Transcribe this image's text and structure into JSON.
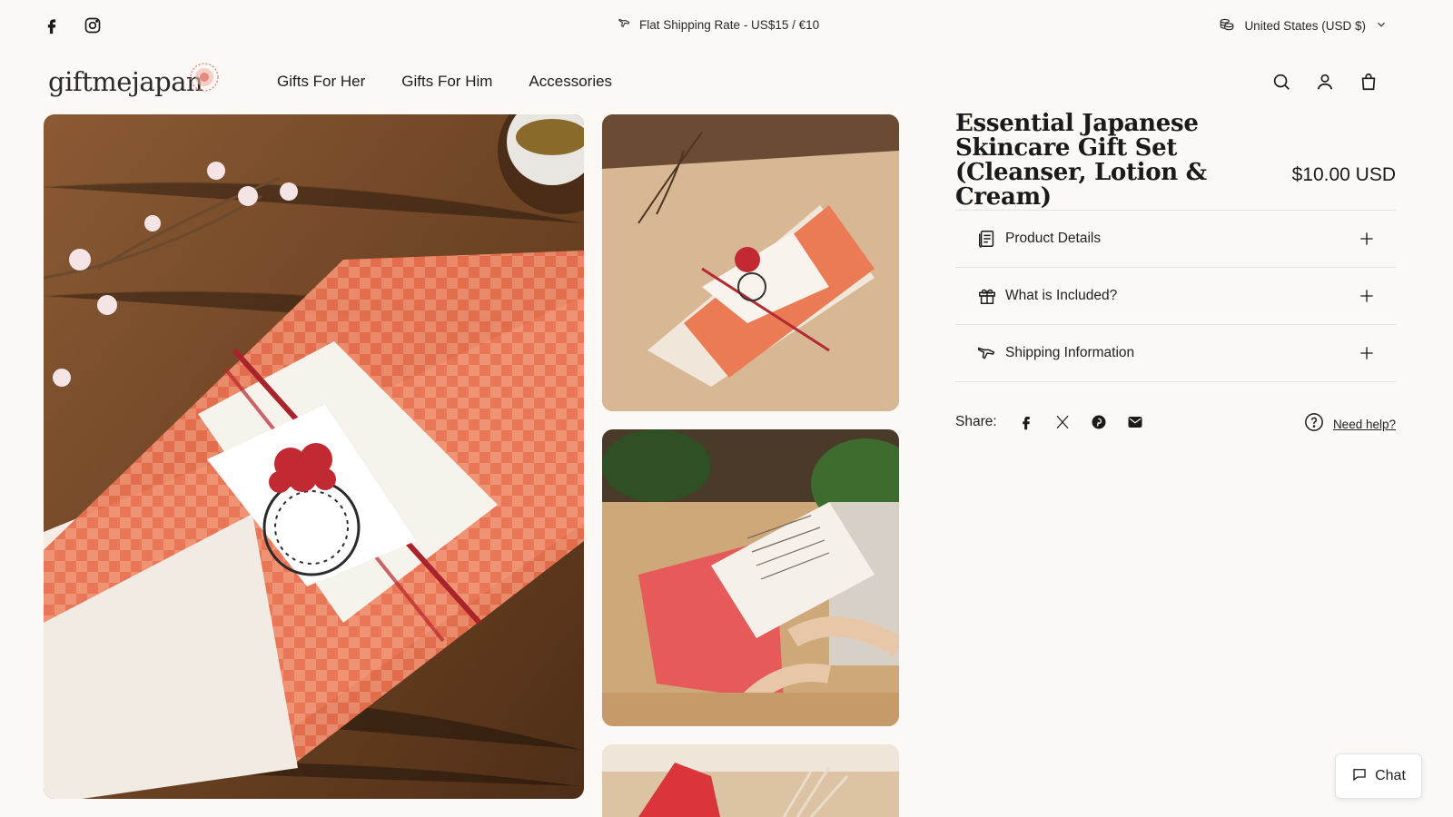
{
  "announcement": {
    "shipping_text": "Flat Shipping Rate - US$15 / €10",
    "currency_label": "United States (USD $)"
  },
  "header": {
    "logo_text": "giftmejapan",
    "nav": [
      "Gifts For Her",
      "Gifts For Him",
      "Accessories"
    ]
  },
  "product": {
    "title": "Essential Japanese Skincare Gift Set (Cleanser, Lotion & Cream)",
    "price": "$10.00 USD",
    "accordions": [
      {
        "label": "Product Details",
        "icon": "document-icon"
      },
      {
        "label": "What is Included?",
        "icon": "gift-icon"
      },
      {
        "label": "Shipping Information",
        "icon": "plane-icon"
      }
    ],
    "share_label": "Share:",
    "help_label": "Need help?"
  },
  "chat": {
    "label": "Chat"
  },
  "colors": {
    "background": "#fbf8f5",
    "accent": "#e06a4a",
    "text": "#1f1f1f"
  }
}
